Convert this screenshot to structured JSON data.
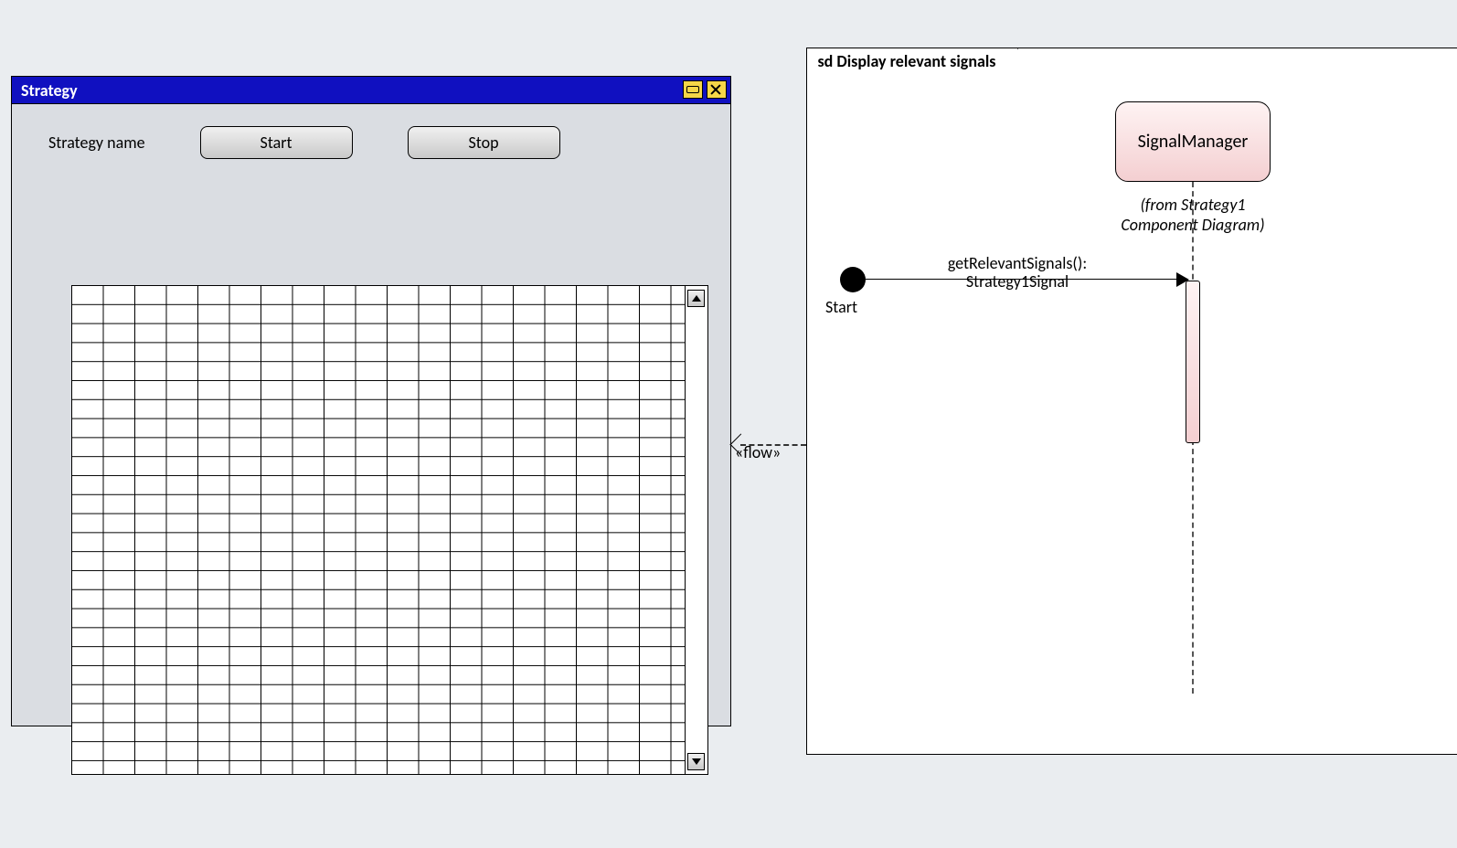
{
  "strategyWindow": {
    "title": "Strategy",
    "label": "Strategy name",
    "buttons": {
      "start": "Start",
      "stop": "Stop"
    }
  },
  "sdFrame": {
    "heading": "sd Display relevant signals",
    "lifeline": {
      "name": "SignalManager",
      "caption1": "(from Strategy1",
      "caption2": "Component Diagram)"
    },
    "start": {
      "label": "Start"
    },
    "message": {
      "line1": "getRelevantSignals():",
      "line2": "Strategy1Signal"
    }
  },
  "flow": {
    "stereotype": "«flow»"
  }
}
